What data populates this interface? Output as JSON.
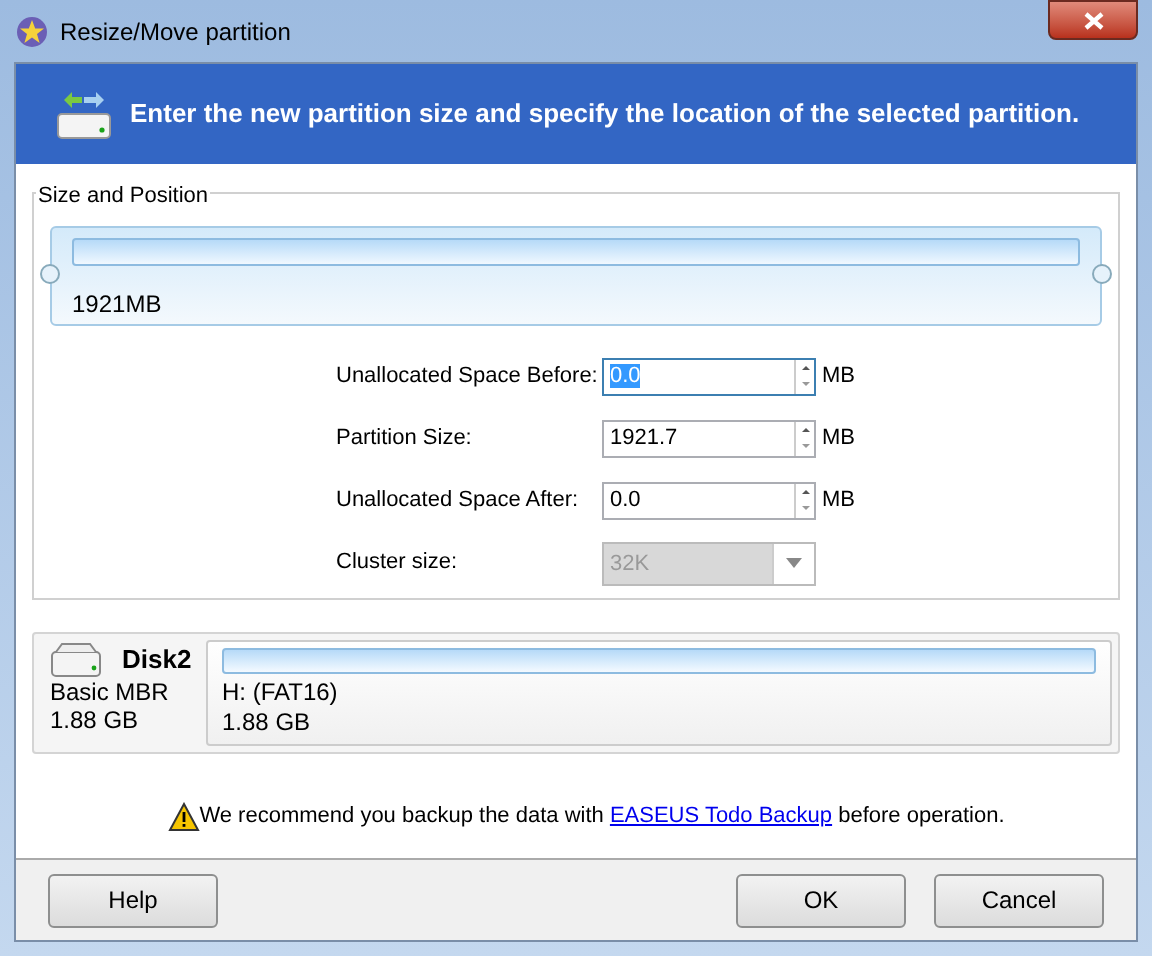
{
  "window": {
    "title": "Resize/Move partition"
  },
  "banner": {
    "text": "Enter the new partition size and specify the location of the selected partition."
  },
  "size_and_position": {
    "title": "Size and Position",
    "bar_label": "1921MB",
    "fields": [
      {
        "kind": "spin",
        "label": "Unallocated Space Before:",
        "value": "0.0",
        "unit": "MB",
        "text_selected": true
      },
      {
        "kind": "spin",
        "label": "Partition Size:",
        "value": "1921.7",
        "unit": "MB",
        "text_selected": false
      },
      {
        "kind": "spin",
        "label": "Unallocated Space After:",
        "value": "0.0",
        "unit": "MB",
        "text_selected": false
      },
      {
        "kind": "dropdown",
        "label": "Cluster size:",
        "value": "32K",
        "disabled": true
      }
    ]
  },
  "disk": {
    "name": "Disk2",
    "type": "Basic MBR",
    "size": "1.88 GB",
    "partition": {
      "label": "H: (FAT16)",
      "size": "1.88 GB"
    }
  },
  "notice": {
    "before": "We recommend you backup the data with ",
    "link": "EASEUS Todo Backup",
    "after": " before operation."
  },
  "left_buttons": [
    "Help"
  ],
  "right_buttons": [
    "OK",
    "Cancel"
  ]
}
